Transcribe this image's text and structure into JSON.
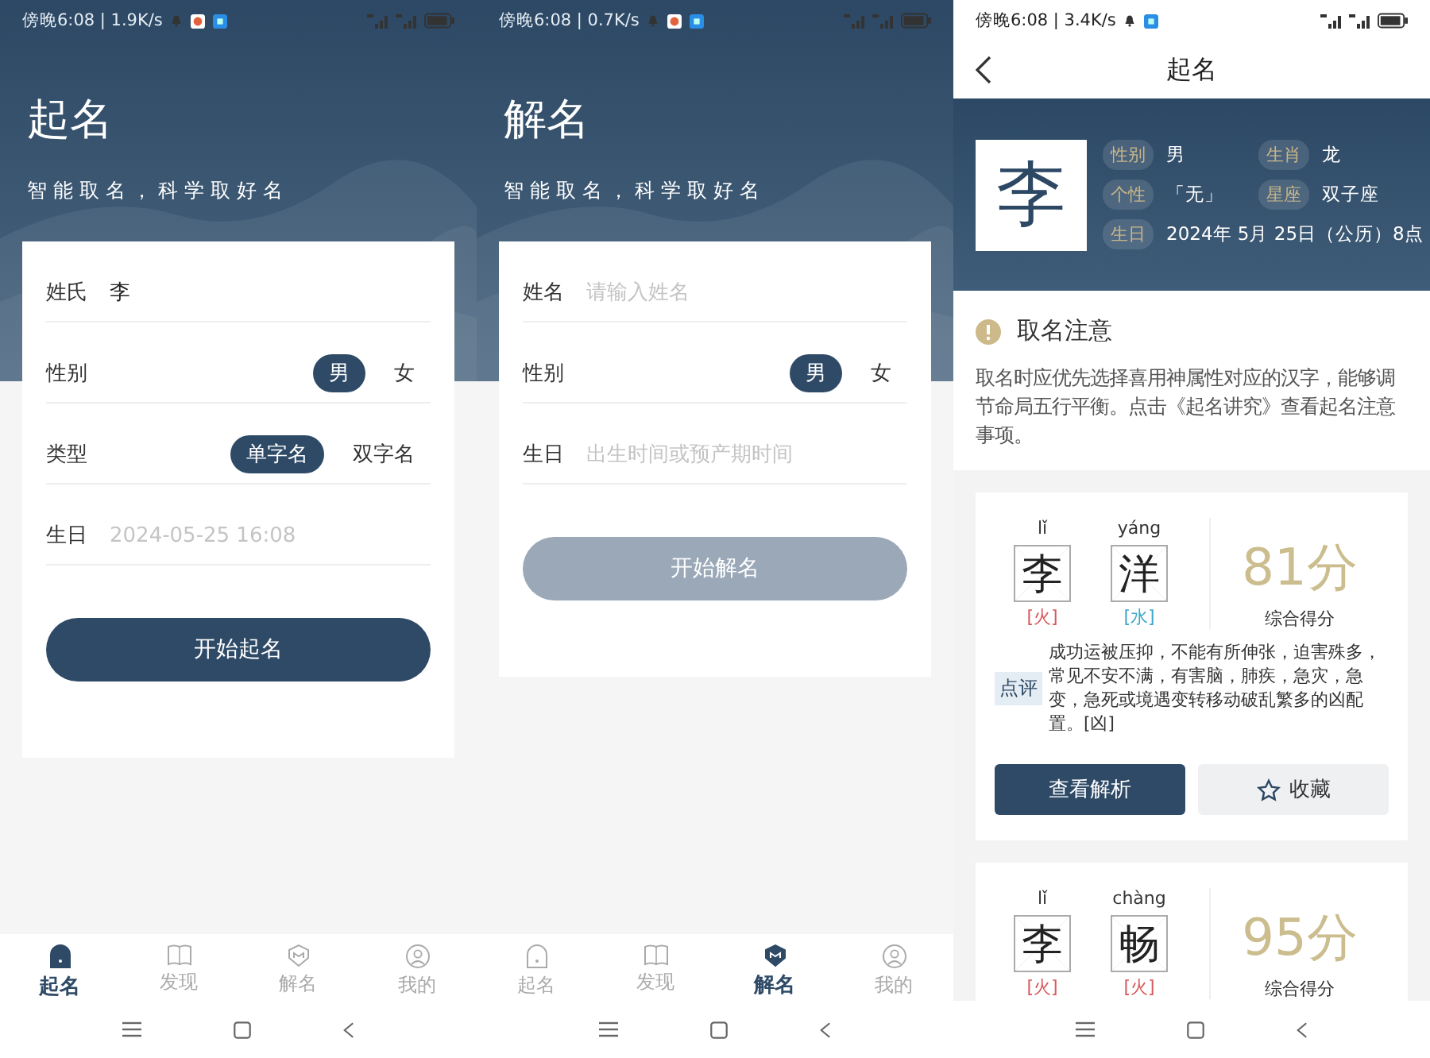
{
  "screens": [
    {
      "kind": "form",
      "status_bar": {
        "text": "傍晚6:08 | 1.9K/s"
      },
      "title": "起名",
      "subtitle": "智能取名，科学取好名",
      "fields": [
        {
          "kind": "text",
          "label": "姓氏",
          "value": "李"
        },
        {
          "kind": "choice",
          "label": "性别",
          "options": [
            {
              "label": "男",
              "selected": true
            },
            {
              "label": "女",
              "selected": false
            }
          ]
        },
        {
          "kind": "choice",
          "label": "类型",
          "options": [
            {
              "label": "单字名",
              "selected": true
            },
            {
              "label": "双字名",
              "selected": false
            }
          ]
        },
        {
          "kind": "text",
          "label": "生日",
          "placeholder": "2024-05-25 16:08"
        }
      ],
      "submit": {
        "label": "开始起名",
        "disabled": false
      },
      "tabs": [
        {
          "label": "起名",
          "selected": true
        },
        {
          "label": "发现",
          "selected": false
        },
        {
          "label": "解名",
          "selected": false
        },
        {
          "label": "我的",
          "selected": false
        }
      ]
    },
    {
      "kind": "form",
      "status_bar": {
        "text": "傍晚6:08 | 0.7K/s"
      },
      "title": "解名",
      "subtitle": "智能取名，科学取好名",
      "fields": [
        {
          "kind": "text",
          "label": "姓名",
          "placeholder": "请输入姓名"
        },
        {
          "kind": "choice",
          "label": "性别",
          "options": [
            {
              "label": "男",
              "selected": true
            },
            {
              "label": "女",
              "selected": false
            }
          ]
        },
        {
          "kind": "text",
          "label": "生日",
          "placeholder": "出生时间或预产期时间"
        }
      ],
      "submit": {
        "label": "开始解名",
        "disabled": true
      },
      "tabs": [
        {
          "label": "起名",
          "selected": false
        },
        {
          "label": "发现",
          "selected": false
        },
        {
          "label": "解名",
          "selected": true
        },
        {
          "label": "我的",
          "selected": false
        }
      ]
    },
    {
      "kind": "result",
      "status_bar": {
        "text": "傍晚6:08 | 3.4K/s"
      },
      "nav_title": "起名",
      "profile": {
        "surname": "李",
        "facts": [
          {
            "label": "性别",
            "value": "男"
          },
          {
            "label": "生肖",
            "value": "龙"
          },
          {
            "label": "个性",
            "value": "「无」"
          },
          {
            "label": "星座",
            "value": "双子座"
          },
          {
            "label": "生日",
            "value": "2024年 5月 25日（公历）8点"
          }
        ]
      },
      "notice": {
        "title": "取名注意",
        "text": "取名时应优先选择喜用神属性对应的汉字，能够调节命局五行平衡。点击《起名讲究》查看起名注意事项。"
      },
      "results": [
        {
          "chars": [
            {
              "pinyin": "lǐ",
              "char": "李",
              "element": "[火]",
              "color": "#d9585a"
            },
            {
              "pinyin": "yáng",
              "char": "洋",
              "element": "[水]",
              "color": "#3aa7c9"
            }
          ],
          "score": "81分",
          "score_label": "综合得分",
          "comment_label": "点评",
          "comment": "成功运被压抑，不能有所伸张，迫害殊多，常见不安不满，有害脑，肺疾，急灾，急变，急死或境遇变转移动破乱繁多的凶配置。[凶]",
          "actions": [
            {
              "kind": "primary",
              "label": "查看解析"
            },
            {
              "kind": "favorite",
              "label": "收藏"
            }
          ]
        },
        {
          "chars": [
            {
              "pinyin": "lǐ",
              "char": "李",
              "element": "[火]",
              "color": "#d9585a"
            },
            {
              "pinyin": "chàng",
              "char": "畅",
              "element": "[火]",
              "color": "#d9585a"
            }
          ],
          "score": "95分",
          "score_label": "综合得分"
        }
      ]
    }
  ]
}
